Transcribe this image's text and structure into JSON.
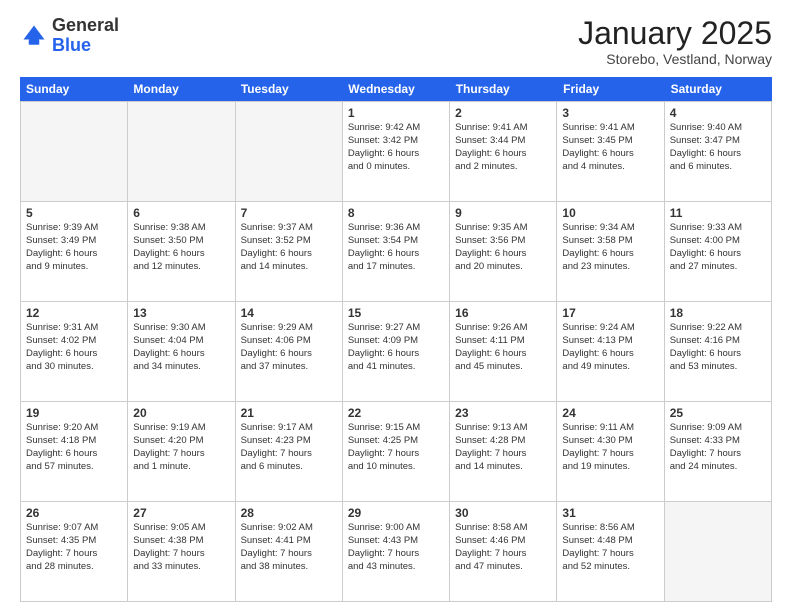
{
  "logo": {
    "general": "General",
    "blue": "Blue"
  },
  "header": {
    "title": "January 2025",
    "location": "Storebo, Vestland, Norway"
  },
  "weekdays": [
    "Sunday",
    "Monday",
    "Tuesday",
    "Wednesday",
    "Thursday",
    "Friday",
    "Saturday"
  ],
  "rows": [
    [
      {
        "day": "",
        "info": "",
        "empty": true
      },
      {
        "day": "",
        "info": "",
        "empty": true
      },
      {
        "day": "",
        "info": "",
        "empty": true
      },
      {
        "day": "1",
        "info": "Sunrise: 9:42 AM\nSunset: 3:42 PM\nDaylight: 6 hours\nand 0 minutes.",
        "empty": false
      },
      {
        "day": "2",
        "info": "Sunrise: 9:41 AM\nSunset: 3:44 PM\nDaylight: 6 hours\nand 2 minutes.",
        "empty": false
      },
      {
        "day": "3",
        "info": "Sunrise: 9:41 AM\nSunset: 3:45 PM\nDaylight: 6 hours\nand 4 minutes.",
        "empty": false
      },
      {
        "day": "4",
        "info": "Sunrise: 9:40 AM\nSunset: 3:47 PM\nDaylight: 6 hours\nand 6 minutes.",
        "empty": false
      }
    ],
    [
      {
        "day": "5",
        "info": "Sunrise: 9:39 AM\nSunset: 3:49 PM\nDaylight: 6 hours\nand 9 minutes.",
        "empty": false
      },
      {
        "day": "6",
        "info": "Sunrise: 9:38 AM\nSunset: 3:50 PM\nDaylight: 6 hours\nand 12 minutes.",
        "empty": false
      },
      {
        "day": "7",
        "info": "Sunrise: 9:37 AM\nSunset: 3:52 PM\nDaylight: 6 hours\nand 14 minutes.",
        "empty": false
      },
      {
        "day": "8",
        "info": "Sunrise: 9:36 AM\nSunset: 3:54 PM\nDaylight: 6 hours\nand 17 minutes.",
        "empty": false
      },
      {
        "day": "9",
        "info": "Sunrise: 9:35 AM\nSunset: 3:56 PM\nDaylight: 6 hours\nand 20 minutes.",
        "empty": false
      },
      {
        "day": "10",
        "info": "Sunrise: 9:34 AM\nSunset: 3:58 PM\nDaylight: 6 hours\nand 23 minutes.",
        "empty": false
      },
      {
        "day": "11",
        "info": "Sunrise: 9:33 AM\nSunset: 4:00 PM\nDaylight: 6 hours\nand 27 minutes.",
        "empty": false
      }
    ],
    [
      {
        "day": "12",
        "info": "Sunrise: 9:31 AM\nSunset: 4:02 PM\nDaylight: 6 hours\nand 30 minutes.",
        "empty": false
      },
      {
        "day": "13",
        "info": "Sunrise: 9:30 AM\nSunset: 4:04 PM\nDaylight: 6 hours\nand 34 minutes.",
        "empty": false
      },
      {
        "day": "14",
        "info": "Sunrise: 9:29 AM\nSunset: 4:06 PM\nDaylight: 6 hours\nand 37 minutes.",
        "empty": false
      },
      {
        "day": "15",
        "info": "Sunrise: 9:27 AM\nSunset: 4:09 PM\nDaylight: 6 hours\nand 41 minutes.",
        "empty": false
      },
      {
        "day": "16",
        "info": "Sunrise: 9:26 AM\nSunset: 4:11 PM\nDaylight: 6 hours\nand 45 minutes.",
        "empty": false
      },
      {
        "day": "17",
        "info": "Sunrise: 9:24 AM\nSunset: 4:13 PM\nDaylight: 6 hours\nand 49 minutes.",
        "empty": false
      },
      {
        "day": "18",
        "info": "Sunrise: 9:22 AM\nSunset: 4:16 PM\nDaylight: 6 hours\nand 53 minutes.",
        "empty": false
      }
    ],
    [
      {
        "day": "19",
        "info": "Sunrise: 9:20 AM\nSunset: 4:18 PM\nDaylight: 6 hours\nand 57 minutes.",
        "empty": false
      },
      {
        "day": "20",
        "info": "Sunrise: 9:19 AM\nSunset: 4:20 PM\nDaylight: 7 hours\nand 1 minute.",
        "empty": false
      },
      {
        "day": "21",
        "info": "Sunrise: 9:17 AM\nSunset: 4:23 PM\nDaylight: 7 hours\nand 6 minutes.",
        "empty": false
      },
      {
        "day": "22",
        "info": "Sunrise: 9:15 AM\nSunset: 4:25 PM\nDaylight: 7 hours\nand 10 minutes.",
        "empty": false
      },
      {
        "day": "23",
        "info": "Sunrise: 9:13 AM\nSunset: 4:28 PM\nDaylight: 7 hours\nand 14 minutes.",
        "empty": false
      },
      {
        "day": "24",
        "info": "Sunrise: 9:11 AM\nSunset: 4:30 PM\nDaylight: 7 hours\nand 19 minutes.",
        "empty": false
      },
      {
        "day": "25",
        "info": "Sunrise: 9:09 AM\nSunset: 4:33 PM\nDaylight: 7 hours\nand 24 minutes.",
        "empty": false
      }
    ],
    [
      {
        "day": "26",
        "info": "Sunrise: 9:07 AM\nSunset: 4:35 PM\nDaylight: 7 hours\nand 28 minutes.",
        "empty": false
      },
      {
        "day": "27",
        "info": "Sunrise: 9:05 AM\nSunset: 4:38 PM\nDaylight: 7 hours\nand 33 minutes.",
        "empty": false
      },
      {
        "day": "28",
        "info": "Sunrise: 9:02 AM\nSunset: 4:41 PM\nDaylight: 7 hours\nand 38 minutes.",
        "empty": false
      },
      {
        "day": "29",
        "info": "Sunrise: 9:00 AM\nSunset: 4:43 PM\nDaylight: 7 hours\nand 43 minutes.",
        "empty": false
      },
      {
        "day": "30",
        "info": "Sunrise: 8:58 AM\nSunset: 4:46 PM\nDaylight: 7 hours\nand 47 minutes.",
        "empty": false
      },
      {
        "day": "31",
        "info": "Sunrise: 8:56 AM\nSunset: 4:48 PM\nDaylight: 7 hours\nand 52 minutes.",
        "empty": false
      },
      {
        "day": "",
        "info": "",
        "empty": true
      }
    ]
  ]
}
